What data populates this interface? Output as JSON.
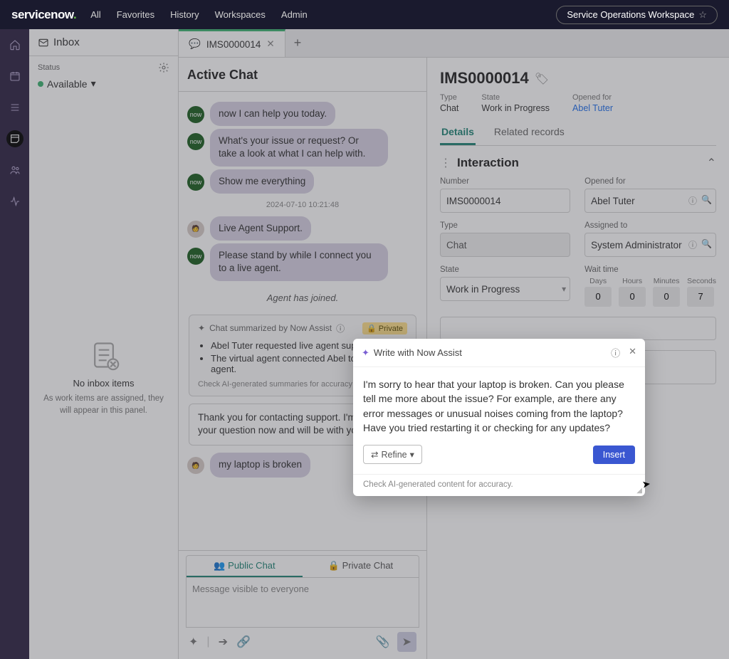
{
  "header": {
    "logo_text": "servicenow",
    "nav": {
      "all": "All",
      "favorites": "Favorites",
      "history": "History",
      "workspaces": "Workspaces",
      "admin": "Admin"
    },
    "workspace_pill": "Service Operations Workspace"
  },
  "inbox": {
    "title": "Inbox",
    "status_label": "Status",
    "status_value": "Available",
    "empty_title": "No inbox items",
    "empty_sub": "As work items are assigned, they will appear in this panel."
  },
  "tabs": {
    "active_label": "IMS0000014",
    "new_tab": "+"
  },
  "chat": {
    "title": "Active Chat",
    "msgs": {
      "m0": "now I can help you today.",
      "m1": "What's your issue or request? Or take a look at what I can help with.",
      "m2": "Show me everything",
      "ts": "2024-07-10 10:21:48",
      "m3": "Live Agent Support.",
      "m4": "Please stand by while I connect you to a live agent.",
      "joined": "Agent has joined.",
      "sum_head": "Chat summarized by Now Assist",
      "sum_private": "🔒 Private",
      "sum1": "Abel Tuter requested live agent support.",
      "sum2": "The virtual agent connected Abel to a live agent.",
      "sum_foot": "Check AI-generated summaries for accuracy",
      "agent1": "Thank you for contacting support. I'm looking into your question now and will be with you shortly.",
      "user1": "my laptop is broken"
    },
    "composer": {
      "tab_public": "Public Chat",
      "tab_private": "Private Chat",
      "placeholder": "Message visible to everyone"
    }
  },
  "detail": {
    "record_id": "IMS0000014",
    "meta": {
      "type_l": "Type",
      "type_v": "Chat",
      "state_l": "State",
      "state_v": "Work in Progress",
      "opened_l": "Opened for",
      "opened_v": "Abel Tuter"
    },
    "tabs": {
      "details": "Details",
      "related": "Related records"
    },
    "section": "Interaction",
    "fields": {
      "number_l": "Number",
      "number_v": "IMS0000014",
      "opened_for_l": "Opened for",
      "opened_for_v": "Abel Tuter",
      "type_l": "Type",
      "type_v": "Chat",
      "assigned_l": "Assigned to",
      "assigned_v": "System Administrator",
      "state_l": "State",
      "state_v": "Work in Progress",
      "wait_l": "Wait time",
      "wait": {
        "days_l": "Days",
        "days_v": "0",
        "hours_l": "Hours",
        "hours_v": "0",
        "minutes_l": "Minutes",
        "minutes_v": "0",
        "seconds_l": "Seconds",
        "seconds_v": "7"
      }
    }
  },
  "now_assist": {
    "title": "Write with Now Assist",
    "body": "I'm sorry to hear that your laptop is broken. Can you please tell me more about the issue? For example, are there any error messages or unusual noises coming from the laptop? Have you tried restarting it or checking for any updates?",
    "refine": "Refine",
    "insert": "Insert",
    "footer": "Check AI-generated content for accuracy."
  }
}
